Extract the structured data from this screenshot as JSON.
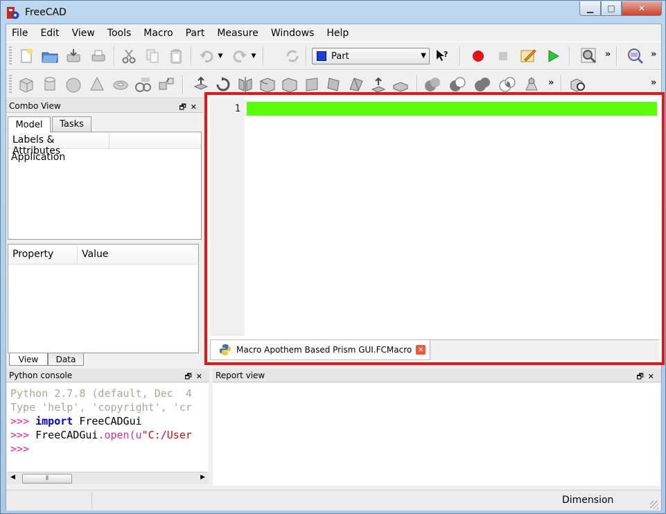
{
  "window": {
    "title": "FreeCAD"
  },
  "menu": [
    "File",
    "Edit",
    "View",
    "Tools",
    "Macro",
    "Part",
    "Measure",
    "Windows",
    "Help"
  ],
  "toolbar": {
    "workbench": "Part",
    "more": "»"
  },
  "combo_view": {
    "title": "Combo View",
    "tabs": [
      "Model",
      "Tasks"
    ],
    "tree_header": "Labels & Attributes",
    "tree_root": "Application",
    "property_columns": [
      "Property",
      "Value"
    ],
    "bottom_tabs": [
      "View",
      "Data"
    ]
  },
  "editor": {
    "line_number": "1",
    "tab_label": "Macro Apothem Based Prism GUI.FCMacro",
    "highlight_color": "#5dfc0a",
    "frame_color": "#ef1212"
  },
  "python_console": {
    "title": "Python console",
    "lines": [
      "Python 2.7.8 (default, Dec  4",
      "Type 'help', 'copyright', 'cr",
      ">>> ",
      "import",
      " FreeCADGui",
      ">>> ",
      "FreeCADGui",
      ".open(u",
      "\"C:/User",
      ">>>"
    ]
  },
  "report_view": {
    "title": "Report view"
  },
  "status": {
    "text": "Dimension"
  }
}
